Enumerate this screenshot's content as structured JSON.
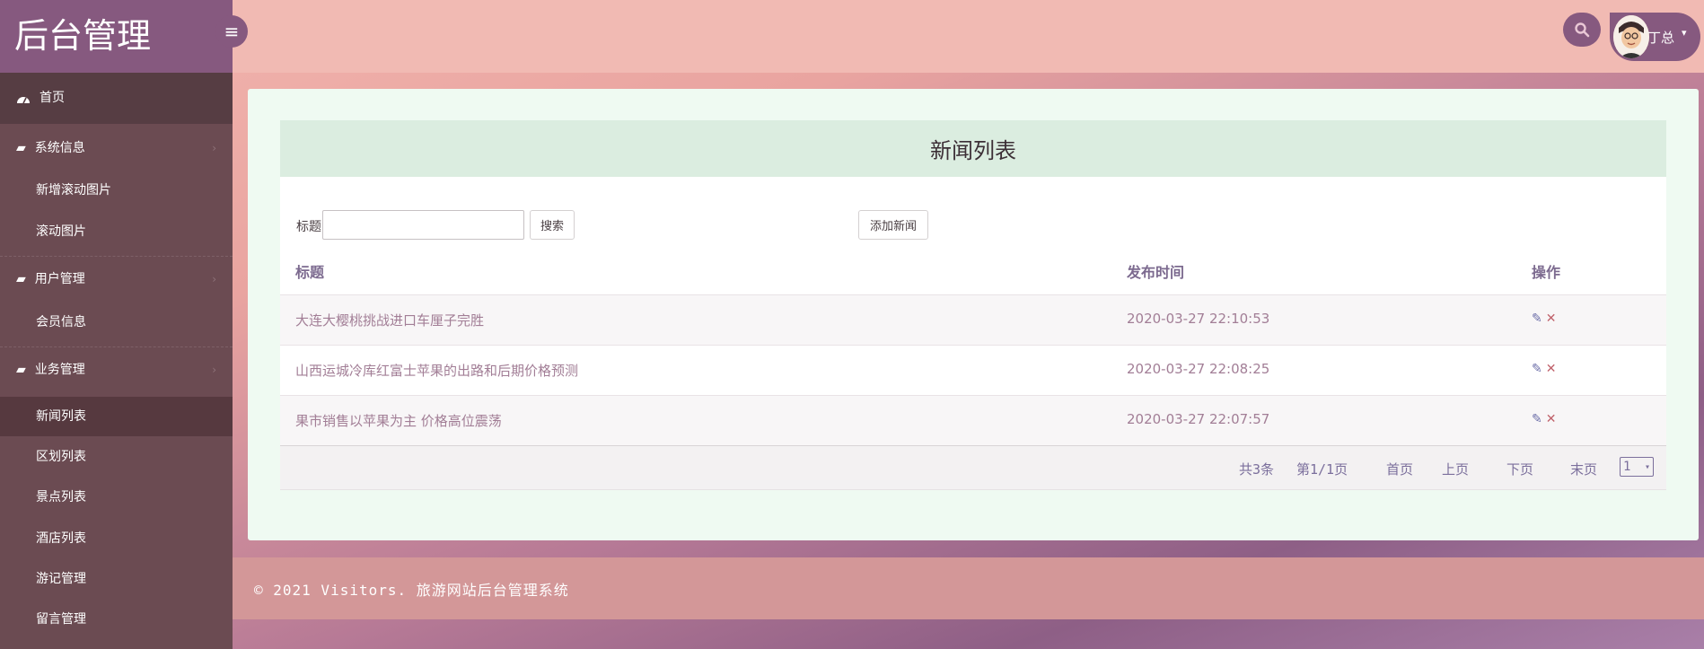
{
  "header": {
    "brand": "后台管理",
    "user_name": "丁总"
  },
  "sidebar": {
    "home": "首页",
    "groups": [
      {
        "label": "系统信息",
        "items": [
          "新增滚动图片",
          "滚动图片"
        ]
      },
      {
        "label": "用户管理",
        "items": [
          "会员信息"
        ]
      },
      {
        "label": "业务管理",
        "items": [
          "新闻列表",
          "区划列表",
          "景点列表",
          "酒店列表",
          "游记管理",
          "留言管理"
        ]
      }
    ],
    "active_item": "新闻列表"
  },
  "main": {
    "panel_title": "新闻列表",
    "search": {
      "label": "标题:",
      "value": "",
      "button": "搜索"
    },
    "add_button": "添加新闻",
    "table": {
      "columns": [
        "标题",
        "发布时间",
        "操作"
      ],
      "rows": [
        {
          "title": "大连大樱桃挑战进口车厘子完胜",
          "time": "2020-03-27 22:10:53"
        },
        {
          "title": "山西运城冷库红富士苹果的出路和后期价格预测",
          "time": "2020-03-27 22:08:25"
        },
        {
          "title": "果市销售以苹果为主 价格高位震荡",
          "time": "2020-03-27 22:07:57"
        }
      ]
    },
    "pager": {
      "total": "共3条",
      "page_info": "第1/1页",
      "first": "首页",
      "prev": "上页",
      "next": "下页",
      "last": "末页",
      "selected_page": "1"
    }
  },
  "footer": {
    "text": "© 2021 Visitors. 旅游网站后台管理系统"
  },
  "colors": {
    "brand_purple": "#86597f",
    "sidebar_bg": "#6b4b52",
    "header_bg": "#f1bab3",
    "link_text": "#a27e96",
    "delete_icon": "#c0626b"
  }
}
